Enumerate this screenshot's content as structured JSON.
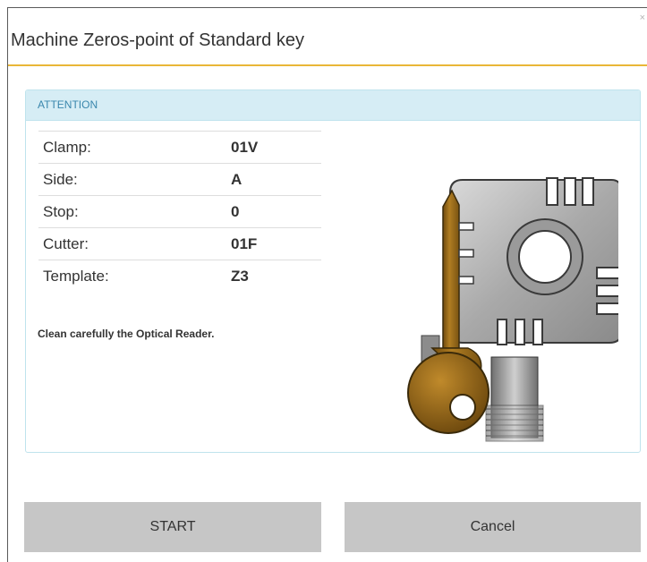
{
  "dialog": {
    "title": "Machine Zeros-point of Standard key",
    "close_glyph": "×"
  },
  "panel": {
    "heading": "ATTENTION",
    "rows": [
      {
        "label": "Clamp:",
        "value": "01V"
      },
      {
        "label": "Side:",
        "value": "A"
      },
      {
        "label": "Stop:",
        "value": "0"
      },
      {
        "label": "Cutter:",
        "value": "01F"
      },
      {
        "label": "Template:",
        "value": "Z3"
      }
    ],
    "note": "Clean carefully the Optical Reader."
  },
  "buttons": {
    "start": "START",
    "cancel": "Cancel"
  },
  "icons": {
    "illustration": "key-clamp-illustration-icon",
    "close": "close-icon"
  },
  "colors": {
    "accent_underline": "#e9b737",
    "panel_header_bg": "#d6edf5",
    "panel_header_text": "#3a87ad",
    "button_bg": "#c6c6c6"
  }
}
